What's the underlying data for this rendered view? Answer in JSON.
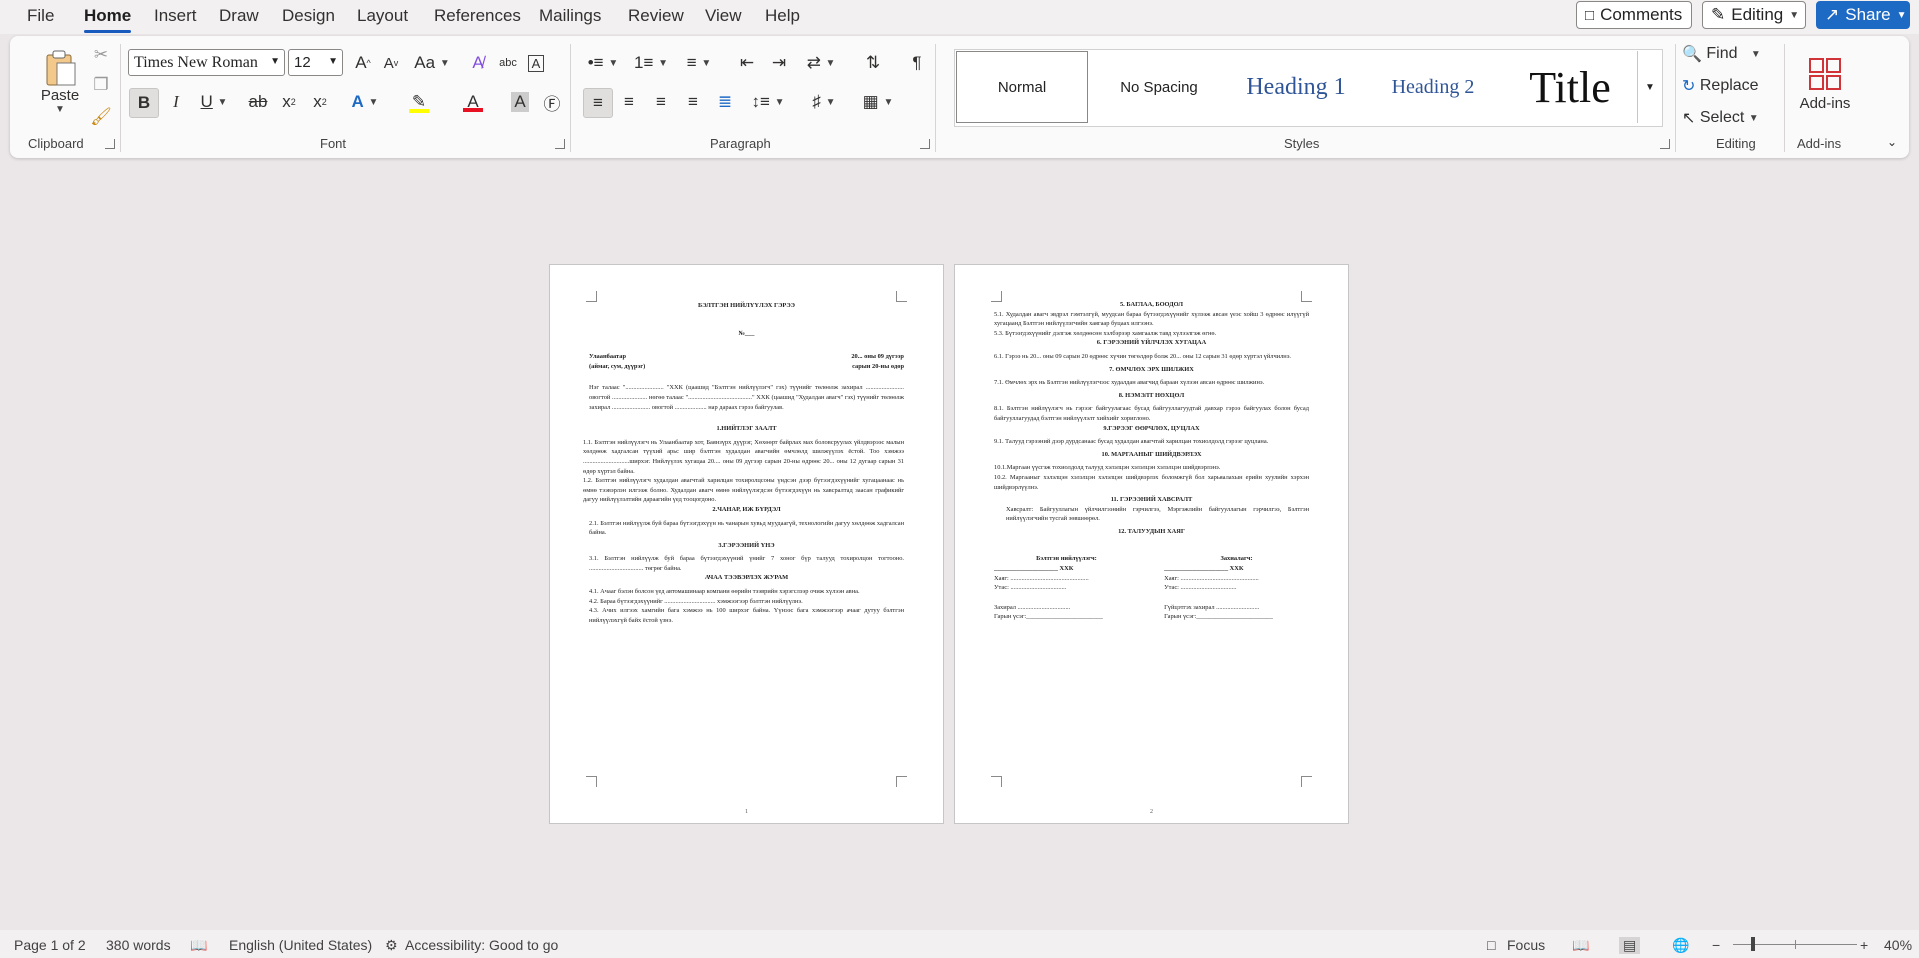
{
  "menu": {
    "tabs": [
      "File",
      "Home",
      "Insert",
      "Draw",
      "Design",
      "Layout",
      "References",
      "Mailings",
      "Review",
      "View",
      "Help"
    ],
    "comments": "Comments",
    "editing": "Editing",
    "share": "Share"
  },
  "ribbon": {
    "clipboard": {
      "paste": "Paste",
      "label": "Clipboard"
    },
    "font": {
      "name": "Times New Roman",
      "size": "12",
      "label": "Font",
      "case_label": "Aa"
    },
    "paragraph": {
      "label": "Paragraph"
    },
    "styles": {
      "items": [
        "Normal",
        "No Spacing",
        "Heading 1",
        "Heading 2",
        "Title"
      ],
      "label": "Styles"
    },
    "editing": {
      "find": "Find",
      "replace": "Replace",
      "select": "Select",
      "label": "Editing"
    },
    "addins": {
      "button": "Add-ins",
      "label": "Add-ins"
    },
    "colors": {
      "accent": "#185abd",
      "highlight": "#ffff00",
      "font_color": "#e81123"
    }
  },
  "page1": {
    "title": "БЭЛТГЭН НИЙЛҮҮЛЭХ ГЭРЭЭ",
    "number": "№___",
    "city": "Улаанбаатар",
    "date1": "20... оны 09 дүгээр",
    "district": "(аймаг, сум, дүүрэг)",
    "date2": "сарын 20-ны өдөр",
    "intro": "Нэг талаас \"........................ \"ХХК (цаашид \"Бэлтгэн нийлүүлэгч\" гэх) түүнийг төлөөлж захирал ........................ овогтой ...................... нөгөө талаас \"........................................\" ХХК (цаашид \"Худалдан авагч\" гэх) түүнийг төлөөлж захирал ........................ овогтой .................... нар дараах гэрээ байгуулав.",
    "s1": "1.НИЙТЛЭГ ЗААЛТ",
    "s1_1": "1.1. Бэлтгэн нийлүүлэгч нь Улаанбаатар хот, Баянзүрх дүүрэг, Хөхөөрт байрлах мах боловсруулах үйлдвэрээс малын хөлдөөж хадгалсан түүхий арьс шир бэлтгэн худалдан авагчийн өмчлөлд шилжүүлэх ёстой. Тоо хэмжээ .............................ширхэг. Нийлүүлэх хугацаа 20.... оны 09 дүгээр сарын 20-ны өдрөөс 20... оны 12 дугаар сарын 31 өдөр хүртэл байна.",
    "s1_2": "1.2. Бэлтгэн нийлүүлэгч худалдан авагчтай харилцан тохиролцсоны үндсэн дээр бүтээгдэхүүнийг хугацаанаас нь өмнө тээвэрлэн илгээж болно. Худалдан авагч өмнө нийлүүлэгдсэн бүтээгдэхүүн нь хавсралтад заасан графикийг дагуу нийлүүлэлтийн дараагийн үед тооцогдоно.",
    "s2": "2.ЧАНАР, ИЖ БҮРДЭЛ",
    "s2_1": "2.1. Бэлтгэн нийлүүлж буй бараа бүтээгдэхүүн нь чанарын хувьд муудаагүй, технологийн дагуу хөлдөөж хадгалсан байна.",
    "s3": "3.ГЭРЭЭНИЙ ҮНЭ",
    "s3_1": "3.1. Бэлтгэн нийлүүлж буй бараа бүтээгдэхүүний үнийг 7 хоног бүр талууд тохиролцон тогтооно. .................................. төгрөг байна.",
    "s4": "АЧАА ТЭЭВЭРЛЭХ ЖУРАМ",
    "s4_1": "4.1. Ачааг бэлэн болсон үед автомашинаар компани өөрийн тээврийн хэрэгслээр очиж хүлээн авна.",
    "s4_2": "4.2. Бараа бүтээгдэхүүнийг ................................ хэмжээгээр бэлтгэн нийлүүлнэ.",
    "s4_3": "4.3. Ачих илгээх хамгийн бага хэмжээ нь 100 ширхэг байна. Үүнээс бага хэмжээгээр ачааг дутуу бэлтгэн нийлүүлэхгүй байх ёстой үзнэ.",
    "pagenum": "1"
  },
  "page2": {
    "s5": "5. БАГЛАА, БООДОЛ",
    "s5_1": "5.1. Худалдан авагч эвдрэл гэмтэлгүй, муудсан бараа бүтээгдэхүүнийг хүлээж авсан үеэс хойш 3 өдрөөс илүүгүй хугацаанд Бэлтгэн нийлүүлэгчийн хаягаар буцаах илгээнэ.",
    "s5_3": "5.3. Бүтээгдэхүүнийг дэлгэж хөлдөөсөн хэлбэрээр хамгаалж тавд хүлээлгэж өгнө.",
    "s6": "6. ГЭРЭЭНИЙ ҮЙЛЧЛЭХ ХУГАЦАА",
    "s6_1": "6.1. Гэрээ нь 20... оны 09 сарын 20 өдрөөс хүчин төгөлдөр болж 20... оны 12 сарын 31 өдөр хүртэл үйлчилнэ.",
    "s7": "7. ӨМЧЛӨХ ЭРХ ШИЛЖИХ",
    "s7_1": "7.1. Өмчлөх эрх нь Бэлтгэн нийлүүлэгчээс худалдан авагчид бараан хүлээн авсан өдрөөс шилжинэ.",
    "s8": "8. НЭМЭЛТ НӨХЦӨЛ",
    "s8_1": "8.1. Бэлтгэн нийлүүлэгч нь гэрээг байгуулагаас бусад байгууллагуудтай давхар гэрээ байгуулах болон бусад байгууллагуудад бэлтгэн нийлүүлэлт хийхийг хориглоно.",
    "s9": "9.ГЭРЭЭГ ӨӨРЧЛӨХ, ЦУЦЛАХ",
    "s9_1": "9.1. Талууд гэрээний дээр дурдсанаас бусад худалдан авагчтай харилцан тохиолдолд гэрээг цуцлана.",
    "s10": "10. МАРГААНЫГ ШИЙДВЭРЛЭХ",
    "s10_1": "10.1.Маргаан үүсгэж тохиолдолд талууд хэлэлцэн хэлэлцэн хэлэлцэн шийдвэрлэнэ.",
    "s10_2": "10.2. Маргааныг хэлэлцэн хэлэлцэн хэлэлцэн шийдвэрлэх боломжгүй бол харьяалахын ерийн хуулийн хэрхэн шийдвэрлүүлнэ.",
    "s11": "11. ГЭРЭЭНИЙ ХАВСРАЛТ",
    "s11_1": "Хавсралт: Байгууллагын үйлчилгээнийн гэрчилгээ, Мэргэжлийн байгууллагын гэрчилгээ, Бэлтгэн нийлүүлэгчийн тусгай зөвшөөрөл.",
    "s12": "12. ТАЛУУДЫН ХАЯГ",
    "supplier": "Бэлтгэн нийлүүлэгч:",
    "buyer": "Захиалагч:",
    "llc_line": "____________________ ХХК",
    "address": "Хаяг: .................................................",
    "phone": "Утас: ...................................",
    "director": "Захирал .................................",
    "director2": "Гүйцэтгэх захирал ...........................",
    "signature": "Гарын үсэг:________________________",
    "pagenum": "2"
  },
  "status": {
    "page": "Page 1 of 2",
    "words": "380 words",
    "language": "English (United States)",
    "accessibility": "Accessibility: Good to go",
    "focus": "Focus",
    "zoom": "40%"
  }
}
